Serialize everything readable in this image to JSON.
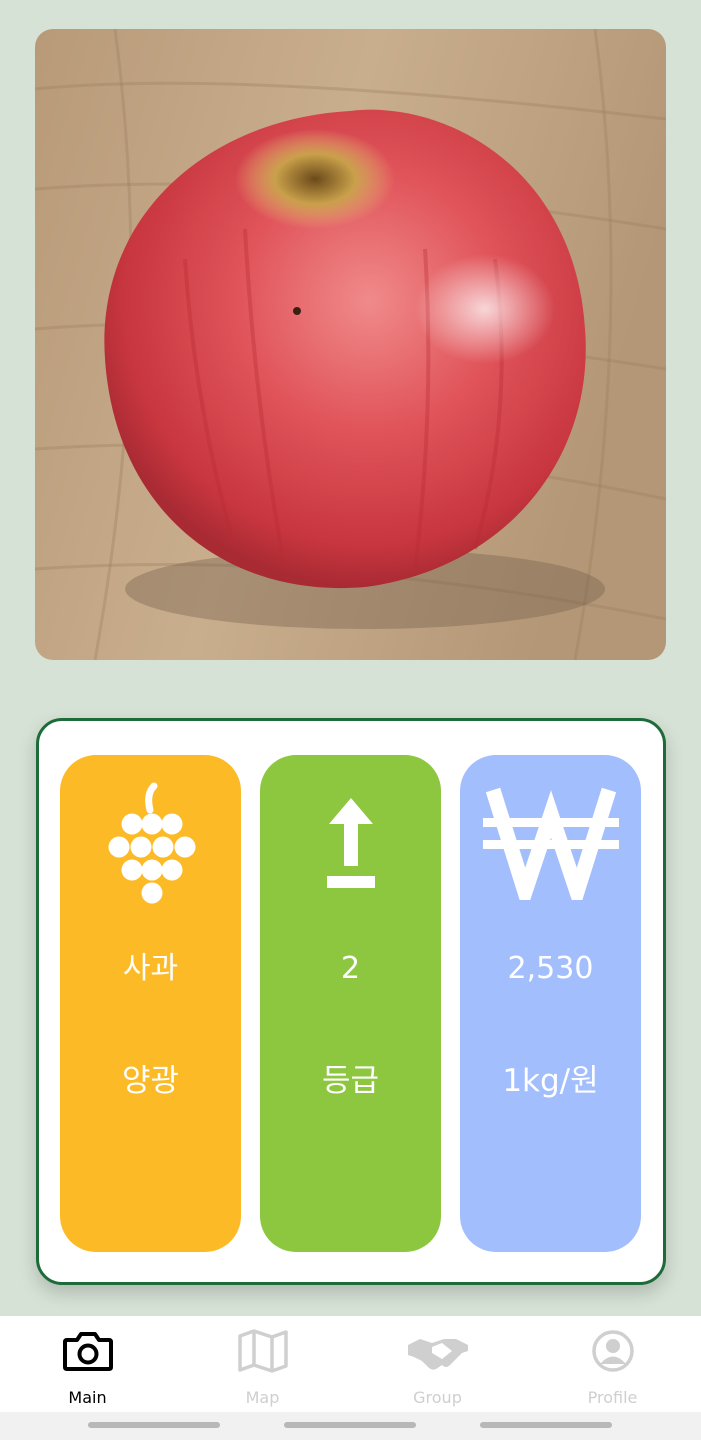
{
  "photo": {
    "subject": "apple"
  },
  "result": {
    "fruit": {
      "icon": "grapes-icon",
      "value": "사과",
      "sub": "양광",
      "color": "#FCBA27"
    },
    "grade": {
      "icon": "upload-arrow-icon",
      "value": "2",
      "sub": "등급",
      "color": "#8DC63F"
    },
    "price": {
      "icon": "won-icon",
      "value": "2,530",
      "sub": "1kg/원",
      "color": "#A3BEFC"
    }
  },
  "nav": {
    "items": [
      {
        "icon": "camera-icon",
        "label": "Main",
        "active": true
      },
      {
        "icon": "map-icon",
        "label": "Map",
        "active": false
      },
      {
        "icon": "handshake-icon",
        "label": "Group",
        "active": false
      },
      {
        "icon": "profile-icon",
        "label": "Profile",
        "active": false
      }
    ],
    "active_color": "#000000",
    "inactive_color": "#CFCFCF"
  },
  "colors": {
    "background": "#D6E2D6",
    "card_border": "#1E6B3A"
  }
}
